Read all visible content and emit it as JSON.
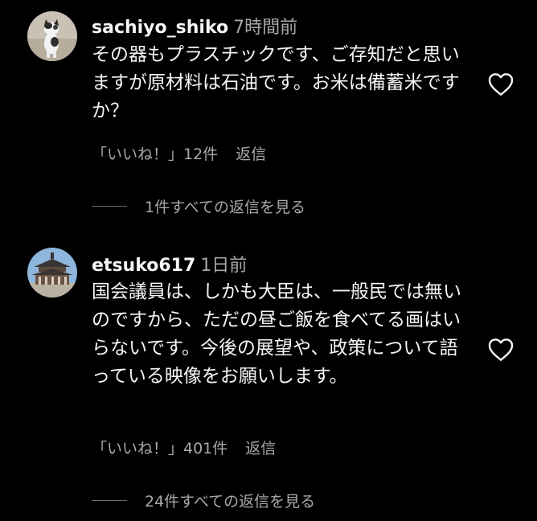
{
  "comments": [
    {
      "username": "sachiyo_shiko",
      "time": "7時間前",
      "text": "その器もプラスチックです、ご存知だと思いますが原材料は石油です。お米は備蓄米ですか？",
      "likes": "「いいね！」12件",
      "reply": "返信",
      "view_replies": "1件すべての返信を見る",
      "avatar_icon": "cat-photo-avatar"
    },
    {
      "username": "etsuko617",
      "time": "1日前",
      "text": "国会議員は、しかも大臣は、一般民では無いのですから、ただの昼ご飯を食べてる画はいらないです。今後の展望や、政策について語っている映像をお願いします。",
      "likes": "「いいね！」401件",
      "reply": "返信",
      "view_replies": "24件すべての返信を見る",
      "avatar_icon": "temple-photo-avatar"
    }
  ],
  "colors": {
    "background": "#000000",
    "primary_text": "#f5f5f5",
    "secondary_text": "#a8a8a8"
  },
  "icons": {
    "like": "heart-outline-icon"
  }
}
